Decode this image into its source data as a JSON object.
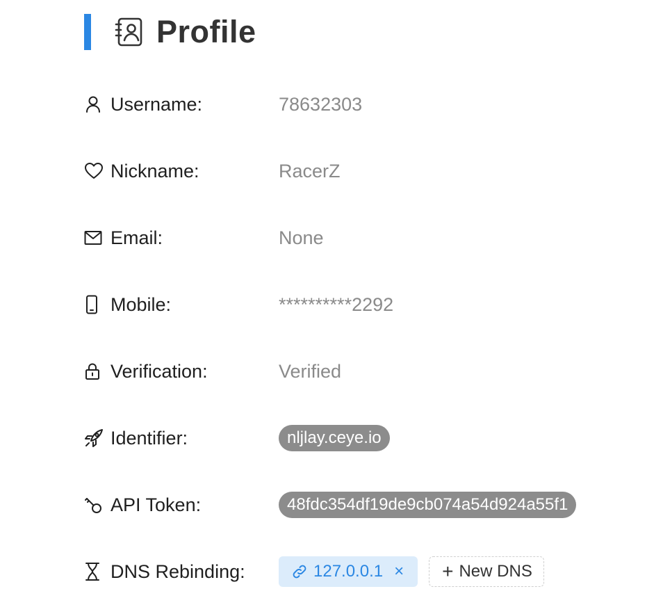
{
  "header": {
    "title": "Profile",
    "accent_color": "#2b87e3",
    "icon": "contact-card-icon"
  },
  "rows": [
    {
      "icon": "user-icon",
      "label": "Username:",
      "value": "78632303"
    },
    {
      "icon": "heart-icon",
      "label": "Nickname:",
      "value": "RacerZ"
    },
    {
      "icon": "mail-icon",
      "label": "Email:",
      "value": "None"
    },
    {
      "icon": "mobile-icon",
      "label": "Mobile:",
      "value": "**********2292"
    },
    {
      "icon": "lock-icon",
      "label": "Verification:",
      "value": "Verified"
    },
    {
      "icon": "rocket-icon",
      "label": "Identifier:",
      "value": "nljlay.ceye.io"
    },
    {
      "icon": "key-icon",
      "label": "API Token:",
      "value": "48fdc354df19de9cb074a54d924a55f1"
    },
    {
      "icon": "hourglass-icon",
      "label": "DNS Rebinding:",
      "value": ""
    }
  ],
  "dns": {
    "tags": [
      {
        "label": "127.0.0.1",
        "icon": "link-icon",
        "close": "×"
      }
    ],
    "add_label": "New DNS",
    "add_icon": "+",
    "tag_color": "#2b87e3",
    "tag_bg": "#dcecfb"
  },
  "colors": {
    "value_text": "#8a8a8a",
    "pill_bg": "#8c8c8c"
  }
}
